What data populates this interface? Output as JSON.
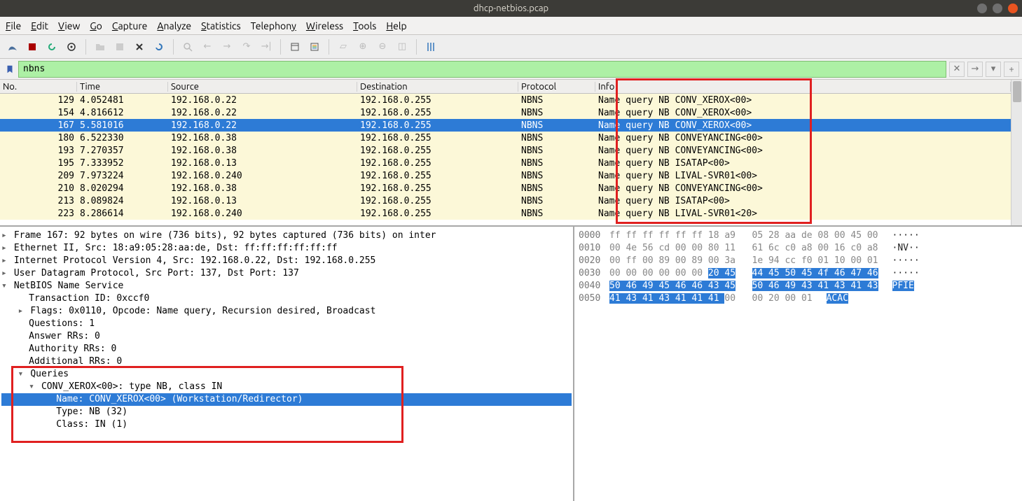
{
  "title": "dhcp-netbios.pcap",
  "menu": {
    "file": "File",
    "edit": "Edit",
    "view": "View",
    "go": "Go",
    "capture": "Capture",
    "analyze": "Analyze",
    "statistics": "Statistics",
    "telephony": "Telephony",
    "wireless": "Wireless",
    "tools": "Tools",
    "help": "Help"
  },
  "filter": {
    "value": "nbns"
  },
  "columns": {
    "no": "No.",
    "time": "Time",
    "source": "Source",
    "dest": "Destination",
    "proto": "Protocol",
    "info": "Info"
  },
  "packets": [
    {
      "no": "129",
      "time": "4.052481",
      "src": "192.168.0.22",
      "dst": "192.168.0.255",
      "proto": "NBNS",
      "info": "Name query NB CONV_XEROX<00>",
      "sel": false
    },
    {
      "no": "154",
      "time": "4.816612",
      "src": "192.168.0.22",
      "dst": "192.168.0.255",
      "proto": "NBNS",
      "info": "Name query NB CONV_XEROX<00>",
      "sel": false
    },
    {
      "no": "167",
      "time": "5.581016",
      "src": "192.168.0.22",
      "dst": "192.168.0.255",
      "proto": "NBNS",
      "info": "Name query NB CONV_XEROX<00>",
      "sel": true
    },
    {
      "no": "180",
      "time": "6.522330",
      "src": "192.168.0.38",
      "dst": "192.168.0.255",
      "proto": "NBNS",
      "info": "Name query NB CONVEYANCING<00>",
      "sel": false
    },
    {
      "no": "193",
      "time": "7.270357",
      "src": "192.168.0.38",
      "dst": "192.168.0.255",
      "proto": "NBNS",
      "info": "Name query NB CONVEYANCING<00>",
      "sel": false
    },
    {
      "no": "195",
      "time": "7.333952",
      "src": "192.168.0.13",
      "dst": "192.168.0.255",
      "proto": "NBNS",
      "info": "Name query NB ISATAP<00>",
      "sel": false
    },
    {
      "no": "209",
      "time": "7.973224",
      "src": "192.168.0.240",
      "dst": "192.168.0.255",
      "proto": "NBNS",
      "info": "Name query NB LIVAL-SVR01<00>",
      "sel": false
    },
    {
      "no": "210",
      "time": "8.020294",
      "src": "192.168.0.38",
      "dst": "192.168.0.255",
      "proto": "NBNS",
      "info": "Name query NB CONVEYANCING<00>",
      "sel": false
    },
    {
      "no": "213",
      "time": "8.089824",
      "src": "192.168.0.13",
      "dst": "192.168.0.255",
      "proto": "NBNS",
      "info": "Name query NB ISATAP<00>",
      "sel": false
    },
    {
      "no": "223",
      "time": "8.286614",
      "src": "192.168.0.240",
      "dst": "192.168.0.255",
      "proto": "NBNS",
      "info": "Name query NB LIVAL-SVR01<20>",
      "sel": false
    }
  ],
  "details": {
    "frame": "Frame 167: 92 bytes on wire (736 bits), 92 bytes captured (736 bits) on inter",
    "eth": "Ethernet II, Src: 18:a9:05:28:aa:de, Dst: ff:ff:ff:ff:ff:ff",
    "ip": "Internet Protocol Version 4, Src: 192.168.0.22, Dst: 192.168.0.255",
    "udp": "User Datagram Protocol, Src Port: 137, Dst Port: 137",
    "nbns": "NetBIOS Name Service",
    "txid": "Transaction ID: 0xccf0",
    "flags": "Flags: 0x0110, Opcode: Name query, Recursion desired, Broadcast",
    "questions": "Questions: 1",
    "answer": "Answer RRs: 0",
    "authority": "Authority RRs: 0",
    "additional": "Additional RRs: 0",
    "queries": "Queries",
    "query1": "CONV_XEROX<00>: type NB, class IN",
    "name": "Name: CONV_XEROX<00> (Workstation/Redirector)",
    "type": "Type: NB (32)",
    "class": "Class: IN (1)"
  },
  "bytes": [
    {
      "off": "0000",
      "hex1": "ff ff ff ff ff ff 18 a9",
      "hex2": "05 28 aa de 08 00 45 00",
      "ascii": "·····"
    },
    {
      "off": "0010",
      "hex1": "00 4e 56 cd 00 00 80 11",
      "hex2": "61 6c c0 a8 00 16 c0 a8",
      "ascii": "·NV··"
    },
    {
      "off": "0020",
      "hex1": "00 ff 00 89 00 89 00 3a",
      "hex2": "1e 94 cc f0 01 10 00 01",
      "ascii": "·····"
    },
    {
      "off": "0030",
      "hex1": "00 00 00 00 00 00 ",
      "hex1b": "20 45",
      "hex2": "44 45 50 45 4f 46 47 46",
      "ascii": "·····",
      "hl": "b2"
    },
    {
      "off": "0040",
      "hex1": "50 46 49 45 46 46 43 45",
      "hex2": "50 46 49 43 41 43 41 43",
      "ascii": "PFIE",
      "hl": "all"
    },
    {
      "off": "0050",
      "hex1": "41 43 41 43 41 41 41 ",
      "hex1c": "00",
      "hex2": "00 20 00 01",
      "ascii": "ACAC",
      "hl": "a"
    }
  ]
}
